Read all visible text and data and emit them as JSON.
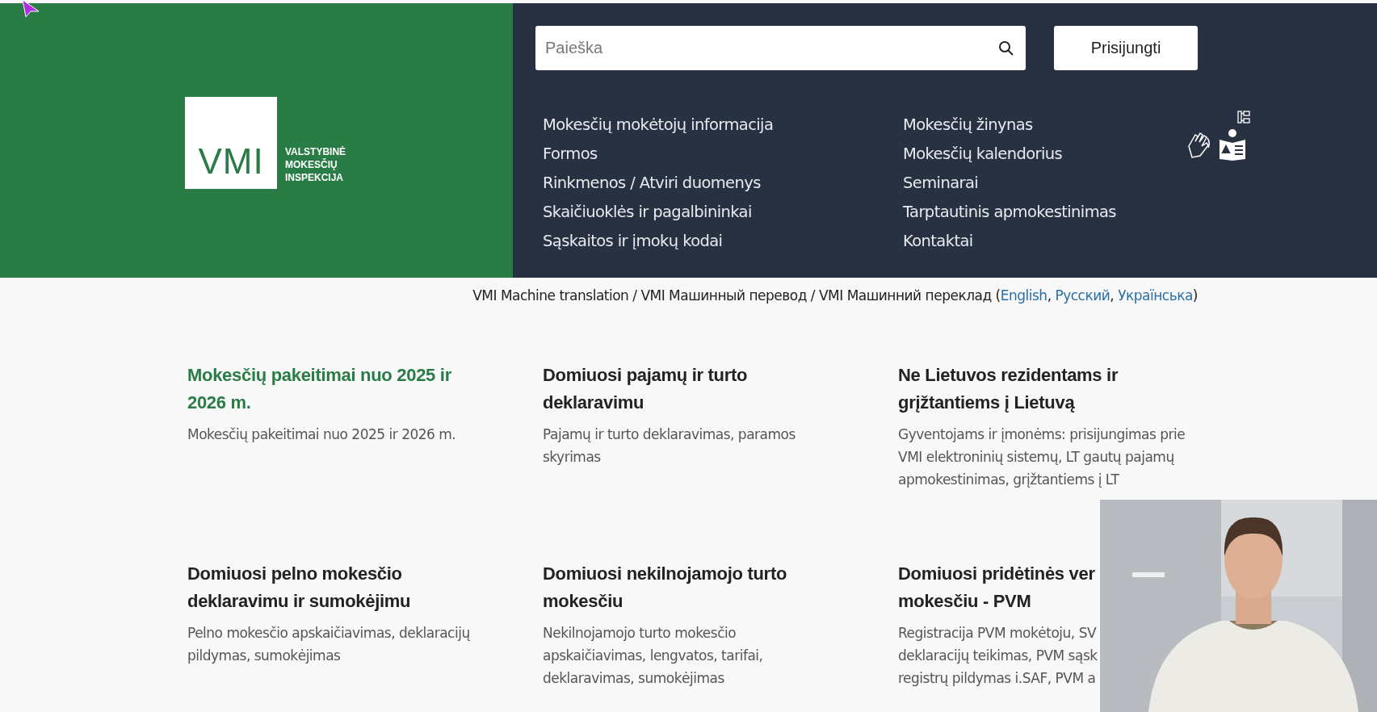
{
  "search": {
    "placeholder": "Paieška"
  },
  "login_button": "Prisijungti",
  "logo": {
    "mark": "VMI",
    "lines": [
      "VALSTYBINĖ",
      "MOKESČIŲ",
      "INSPEKCIJA"
    ]
  },
  "nav_columns": [
    [
      "Mokesčių mokėtojų informacija",
      "Formos",
      "Rinkmenos / Atviri duomenys",
      "Skaičiuoklės ir pagalbininkai",
      "Sąskaitos ir įmokų kodai"
    ],
    [
      "Mokesčių žinynas",
      "Mokesčių kalendorius",
      "Seminarai",
      "Tarptautinis apmokestinimas",
      "Kontaktai"
    ]
  ],
  "translation": {
    "text": "VMI Machine translation / VMI Машинный перевод / VMI Машинний переклад (",
    "links": [
      "English",
      "Русский",
      "Українська"
    ],
    "separator": ", ",
    "close": ")"
  },
  "cards": [
    {
      "title_lines": [
        "Mokesčių pakeitimai nuo 2025 ir",
        "2026 m."
      ],
      "highlighted": true,
      "description_lines": [
        "Mokesčių pakeitimai nuo 2025 ir 2026 m."
      ]
    },
    {
      "title_lines": [
        "Domiuosi pajamų ir turto",
        "deklaravimu"
      ],
      "highlighted": false,
      "description_lines": [
        "Pajamų ir turto deklaravimas, paramos",
        "skyrimas"
      ]
    },
    {
      "title_lines": [
        "Ne Lietuvos rezidentams ir",
        "grįžtantiems į Lietuvą"
      ],
      "highlighted": false,
      "description_lines": [
        "Gyventojams ir įmonėms: prisijungimas prie",
        "VMI elektroninių sistemų, LT gautų pajamų",
        "apmokestinimas, grįžtantiems į LT"
      ]
    },
    {
      "title_lines": [
        "Domiuosi pelno mokesčio",
        "deklaravimu ir sumokėjimu"
      ],
      "highlighted": false,
      "description_lines": [
        "Pelno mokesčio apskaičiavimas, deklaracijų",
        "pildymas, sumokėjimas"
      ]
    },
    {
      "title_lines": [
        "Domiuosi nekilnojamojo turto",
        "mokesčiu"
      ],
      "highlighted": false,
      "description_lines": [
        "Nekilnojamojo turto mokesčio",
        "apskaičiavimas, lengvatos, tarifai,",
        "deklaravimas, sumokėjimas"
      ]
    },
    {
      "title_lines": [
        "Domiuosi pridėtinės ver",
        "mokesčiu - PVM"
      ],
      "highlighted": false,
      "description_lines": [
        "Registracija PVM mokėtoju, SV",
        "deklaracijų teikimas, PVM sąsk",
        "registrų pildymas i.SAF, PVM a"
      ]
    }
  ],
  "video_overlay": {
    "kind": "picture"
  }
}
